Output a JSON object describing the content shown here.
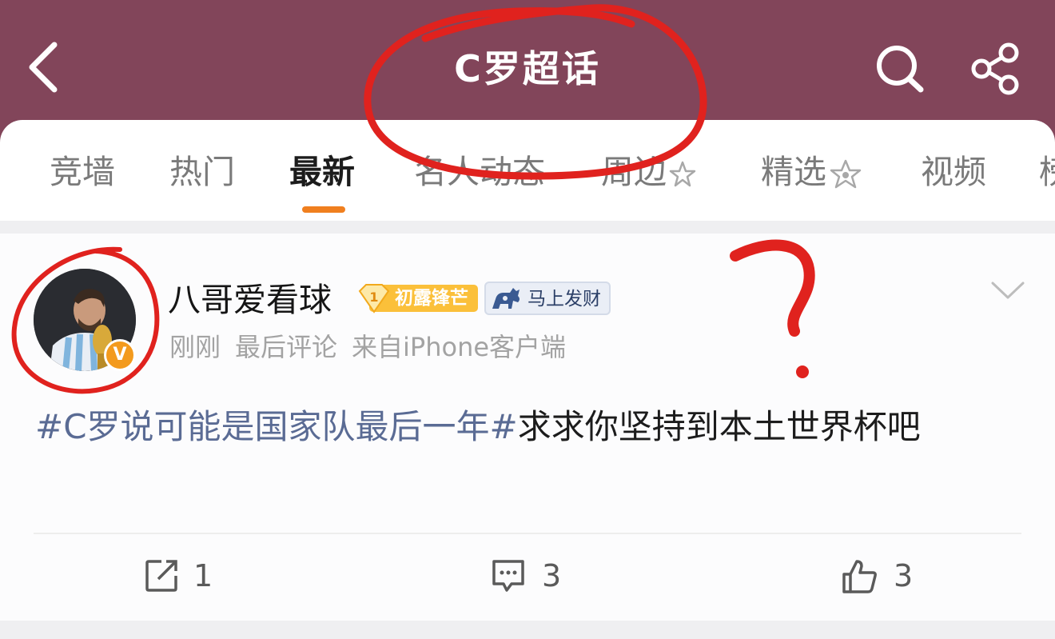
{
  "header": {
    "title": "C罗超话",
    "back_icon": "chevron-left-icon",
    "search_icon": "search-icon",
    "share_icon": "share-icon",
    "background_color": "#82455a"
  },
  "tabs": {
    "items": [
      {
        "label": "竞墙"
      },
      {
        "label": "热门"
      },
      {
        "label": "最新",
        "active": true
      },
      {
        "label": "名人动态"
      },
      {
        "label": "周边"
      },
      {
        "label": "精选"
      },
      {
        "label": "视频"
      },
      {
        "label": "榜"
      }
    ],
    "active_color": "#f07f1f"
  },
  "post": {
    "author": "八哥爱看球",
    "level_badge": {
      "number": "1",
      "label": "初露锋芒"
    },
    "horse_badge": "马上发财",
    "verified_mark": "V",
    "time": "刚刚",
    "last_comment": "最后评论",
    "source": "来自iPhone客户端",
    "hashtag": "#C罗说可能是国家队最后一年#",
    "text": "求求你坚持到本土世界杯吧",
    "actions": {
      "repost_count": "1",
      "comment_count": "3",
      "like_count": "3"
    },
    "hashtag_color": "#5a6b94"
  }
}
